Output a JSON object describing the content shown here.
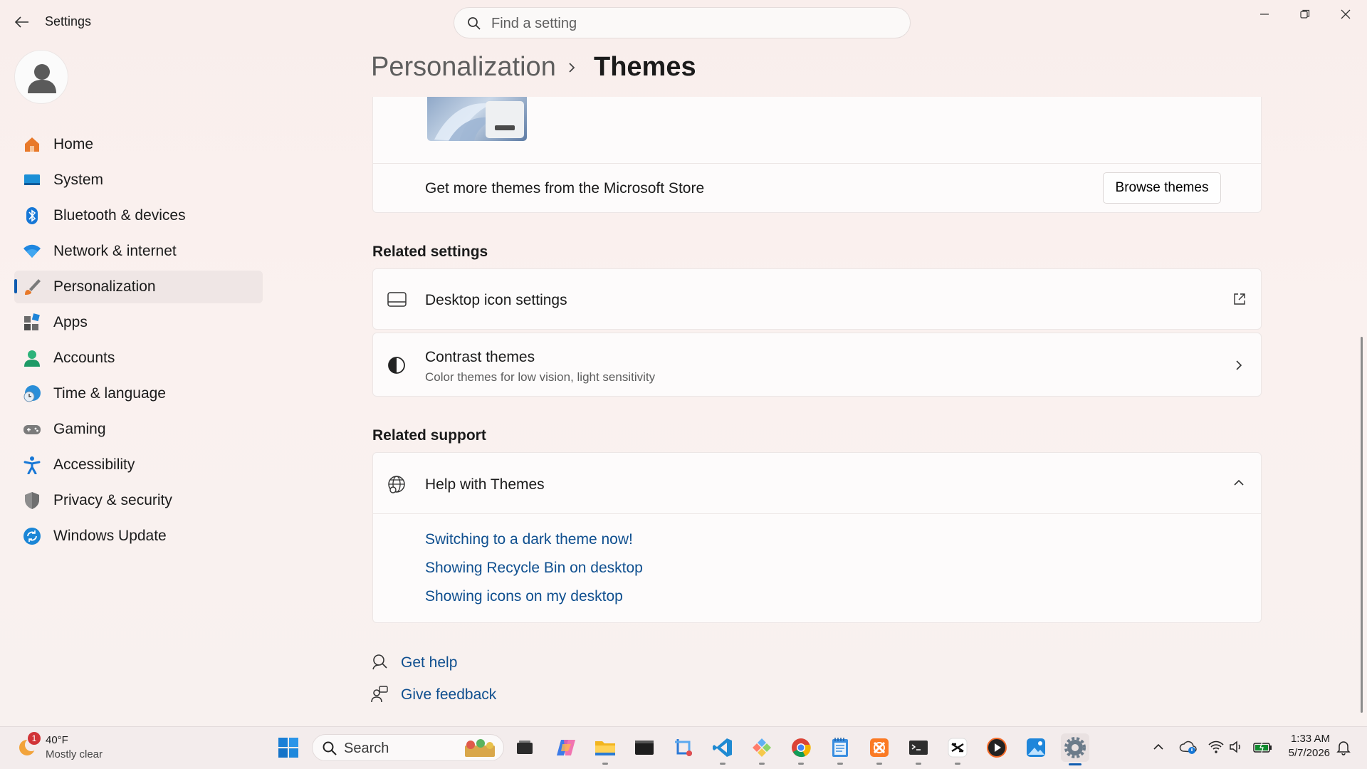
{
  "app": {
    "title": "Settings"
  },
  "search": {
    "placeholder": "Find a setting"
  },
  "sidebar": {
    "items": [
      {
        "label": "Home",
        "icon": "home-icon"
      },
      {
        "label": "System",
        "icon": "system-icon"
      },
      {
        "label": "Bluetooth & devices",
        "icon": "bluetooth-icon"
      },
      {
        "label": "Network & internet",
        "icon": "wifi-icon"
      },
      {
        "label": "Personalization",
        "icon": "brush-icon",
        "active": true
      },
      {
        "label": "Apps",
        "icon": "apps-icon"
      },
      {
        "label": "Accounts",
        "icon": "accounts-icon"
      },
      {
        "label": "Time & language",
        "icon": "time-language-icon"
      },
      {
        "label": "Gaming",
        "icon": "gamepad-icon"
      },
      {
        "label": "Accessibility",
        "icon": "accessibility-icon"
      },
      {
        "label": "Privacy & security",
        "icon": "shield-icon"
      },
      {
        "label": "Windows Update",
        "icon": "update-icon"
      }
    ]
  },
  "breadcrumb": {
    "parent": "Personalization",
    "current": "Themes"
  },
  "store": {
    "text": "Get more themes from the Microsoft Store",
    "button": "Browse themes"
  },
  "related_settings": {
    "heading": "Related settings",
    "desktop_icons": {
      "title": "Desktop icon settings"
    },
    "contrast": {
      "title": "Contrast themes",
      "subtitle": "Color themes for low vision, light sensitivity"
    }
  },
  "related_support": {
    "heading": "Related support",
    "help": {
      "title": "Help with Themes",
      "links": [
        "Switching to a dark theme now!",
        "Showing Recycle Bin on desktop",
        "Showing icons on my desktop"
      ]
    }
  },
  "footer": {
    "get_help": "Get help",
    "feedback": "Give feedback"
  },
  "taskbar": {
    "weather": {
      "temp": "40°F",
      "condition": "Mostly clear",
      "badge": "1"
    },
    "search_label": "Search",
    "time": "1:33 AM",
    "date": "5/7/2026"
  },
  "colors": {
    "accent": "#0f5cb0",
    "link": "#0f4f8f"
  }
}
